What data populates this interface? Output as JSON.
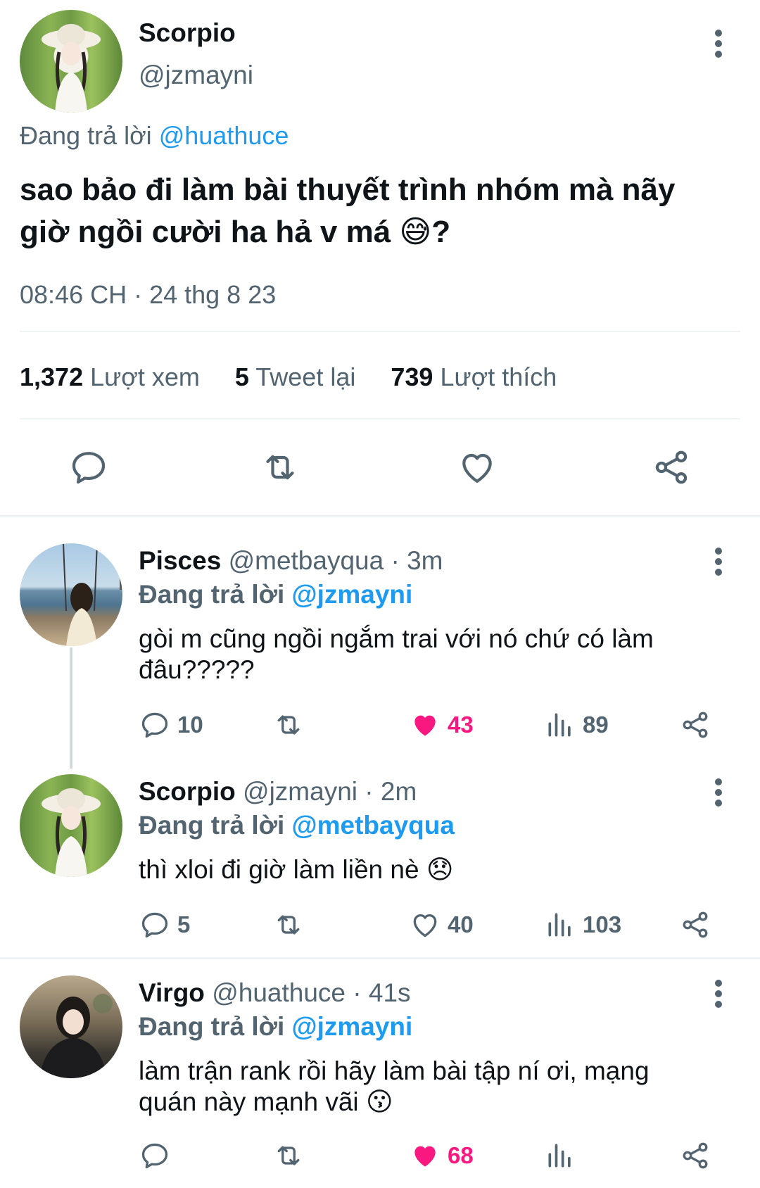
{
  "main_tweet": {
    "display_name": "Scorpio",
    "handle": "@jzmayni",
    "replying_prefix": "Đang trả lời",
    "replying_to": "@huathuce",
    "text_line1": "sao bảo đi làm bài thuyết trình nhóm mà nãy",
    "text_line2": "giờ ngồi cười ha hả v má",
    "emoji": "😅",
    "text_suffix": "?",
    "timestamp": "08:46 CH · 24 thg 8 23",
    "stats": {
      "views_count": "1,372",
      "views_label": "Lượt xem",
      "retweets_count": "5",
      "retweets_label": "Tweet lại",
      "likes_count": "739",
      "likes_label": "Lượt thích"
    }
  },
  "replies": [
    {
      "display_name": "Pisces",
      "handle": "@metbayqua",
      "time": " · 3m",
      "replying_prefix": "Đang trả lời",
      "replying_to": "@jzmayni",
      "text_line1": "gòi m cũng ngồi ngắm trai với nó chứ có làm",
      "text_line2": "đâu?????",
      "reply_count": "10",
      "like_count": "43",
      "liked": true,
      "view_count": "89"
    },
    {
      "display_name": "Scorpio",
      "handle": "@jzmayni",
      "time": " · 2m",
      "replying_prefix": "Đang trả lời",
      "replying_to": "@metbayqua",
      "text_line1": "thì xloi đi giờ làm liền nè",
      "emoji": "😞",
      "reply_count": "5",
      "like_count": "40",
      "liked": false,
      "view_count": "103"
    },
    {
      "display_name": "Virgo",
      "handle": "@huathuce",
      "time": " · 41s",
      "replying_prefix": "Đang trả lời",
      "replying_to": "@jzmayni",
      "text_line1": "làm trận rank rồi hãy làm bài tập ní ơi, mạng",
      "text_line2": "quán này mạnh vãi",
      "emoji": "😗",
      "like_count": "68",
      "liked": true
    }
  ],
  "colors": {
    "link": "#1d9bf0",
    "muted": "#536471",
    "like": "#f91880",
    "divider": "#eff3f4"
  },
  "icons": [
    "reply-icon",
    "retweet-icon",
    "like-icon",
    "share-icon",
    "views-icon",
    "more-icon"
  ]
}
